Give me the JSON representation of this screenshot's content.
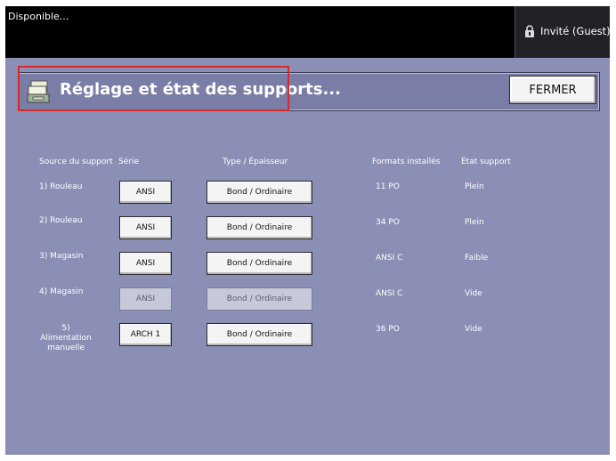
{
  "header": {
    "status": "Disponible...",
    "user_label": "Invité (Guest)"
  },
  "dialog": {
    "title": "Réglage et état des supports...",
    "close_label": "FERMER"
  },
  "table": {
    "columns": {
      "source": "Source du support",
      "serie": "Série",
      "type": "Type / Épaisseur",
      "formats": "Formats installés",
      "etat": "État support"
    },
    "rows": [
      {
        "source": "1) Rouleau",
        "serie": "ANSI",
        "type": "Bond / Ordinaire",
        "formats": "11 PO",
        "etat": "Plein",
        "enabled": true
      },
      {
        "source": "2) Rouleau",
        "serie": "ANSI",
        "type": "Bond / Ordinaire",
        "formats": "34 PO",
        "etat": "Plein",
        "enabled": true
      },
      {
        "source": "3) Magasin",
        "serie": "ANSI",
        "type": "Bond / Ordinaire",
        "formats": "ANSI C",
        "etat": "Faible",
        "enabled": true
      },
      {
        "source": "4) Magasin",
        "serie": "ANSI",
        "type": "Bond / Ordinaire",
        "formats": "ANSI C",
        "etat": "Vide",
        "enabled": false
      },
      {
        "source_line1": "5) Alimentation",
        "source_line2": "manuelle",
        "serie": "ARCH 1",
        "type": "Bond / Ordinaire",
        "formats": "36 PO",
        "etat": "Vide",
        "enabled": true
      }
    ]
  },
  "colors": {
    "background": "#8c8fb5",
    "topbar": "#000000",
    "highlight": "#d8282a"
  }
}
